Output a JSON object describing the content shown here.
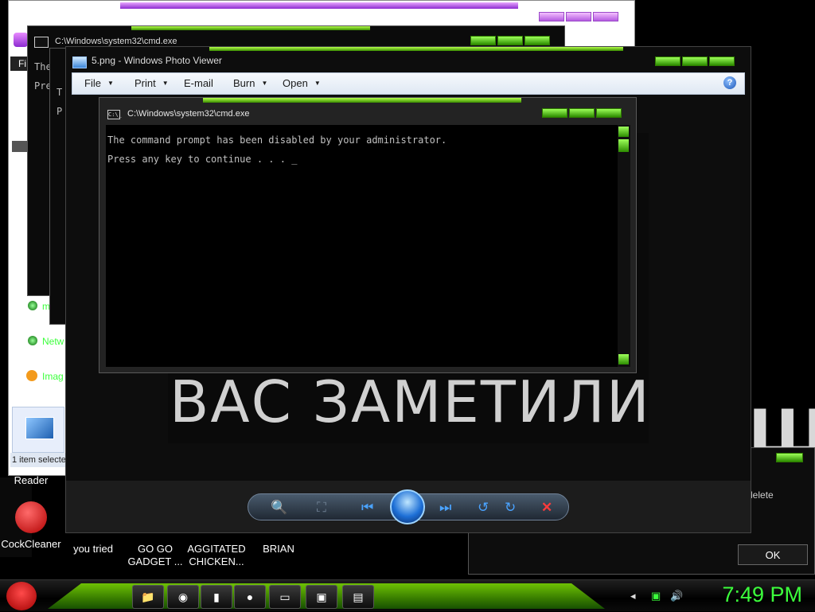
{
  "desktop": {
    "bg_text_right": "Ш",
    "icons": [
      {
        "label": "Reader"
      },
      {
        "label": "CockCleaner"
      },
      {
        "label": "you tried"
      },
      {
        "label": "GO GO GADGET ..."
      },
      {
        "label": "AGGITATED CHICKEN..."
      },
      {
        "label": "BRIAN"
      }
    ]
  },
  "explorer": {
    "menu_partial": "Fi",
    "status": "1 item selecte",
    "side_items": [
      {
        "label": "m"
      },
      {
        "label": "Netw"
      },
      {
        "label": "Imag"
      }
    ]
  },
  "cmd_back": {
    "title": "C:\\Windows\\system32\\cmd.exe",
    "line1_partial": "The",
    "line2_partial": "Pre",
    "line3_partial": "T",
    "line4_partial": "P"
  },
  "photo_viewer": {
    "title": "5.png - Windows Photo Viewer",
    "menu": [
      "File",
      "Print",
      "E-mail",
      "Burn",
      "Open"
    ],
    "help_glyph": "?",
    "image_text": "ВАС ЗАМЕТИЛИ",
    "toolbar": {
      "zoom_icon": "magnifier-icon",
      "fit_icon": "fit-icon",
      "prev_icon": "previous-icon",
      "slideshow_icon": "slideshow-icon",
      "next_icon": "next-icon",
      "rotate_ccw_icon": "rotate-left-icon",
      "rotate_cw_icon": "rotate-right-icon",
      "delete_icon": "delete-icon"
    }
  },
  "cmd": {
    "title": "C:\\Windows\\system32\\cmd.exe",
    "icon_text": "C:\\_",
    "lines": [
      "The command prompt has been disabled by your administrator.",
      "Press any key to continue . . . _"
    ]
  },
  "dialog": {
    "text_partial": "delete",
    "ok_label": "OK"
  },
  "taskbar": {
    "clock": "7:49 PM",
    "accent_color": "#3cff3c",
    "buttons": [
      "folder-icon",
      "chrome-icon",
      "book-icon",
      "angry-birds-icon",
      "cmd-icon",
      "photo-viewer-icon",
      "notepad-icon"
    ]
  }
}
